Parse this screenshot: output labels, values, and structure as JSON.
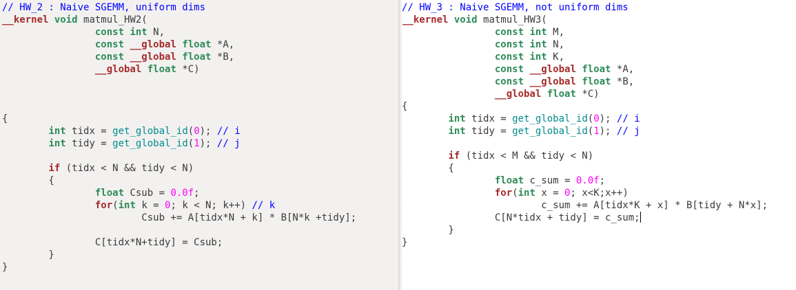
{
  "panes": [
    {
      "id": "hw2",
      "lines": [
        [
          {
            "t": "c",
            "v": "// HW_2 : Naive SGEMM, uniform dims"
          }
        ],
        [
          {
            "t": "k",
            "v": "__kernel"
          },
          {
            "t": "p",
            "v": " "
          },
          {
            "t": "t",
            "v": "void"
          },
          {
            "t": "p",
            "v": " matmul_HW2("
          }
        ],
        [
          {
            "t": "p",
            "v": "                "
          },
          {
            "t": "t",
            "v": "const"
          },
          {
            "t": "p",
            "v": " "
          },
          {
            "t": "t",
            "v": "int"
          },
          {
            "t": "p",
            "v": " N,"
          }
        ],
        [
          {
            "t": "p",
            "v": "                "
          },
          {
            "t": "t",
            "v": "const"
          },
          {
            "t": "p",
            "v": " "
          },
          {
            "t": "k",
            "v": "__global"
          },
          {
            "t": "p",
            "v": " "
          },
          {
            "t": "t",
            "v": "float"
          },
          {
            "t": "p",
            "v": " *A,"
          }
        ],
        [
          {
            "t": "p",
            "v": "                "
          },
          {
            "t": "t",
            "v": "const"
          },
          {
            "t": "p",
            "v": " "
          },
          {
            "t": "k",
            "v": "__global"
          },
          {
            "t": "p",
            "v": " "
          },
          {
            "t": "t",
            "v": "float"
          },
          {
            "t": "p",
            "v": " *B,"
          }
        ],
        [
          {
            "t": "p",
            "v": "                "
          },
          {
            "t": "k",
            "v": "__global"
          },
          {
            "t": "p",
            "v": " "
          },
          {
            "t": "t",
            "v": "float"
          },
          {
            "t": "p",
            "v": " *C)"
          }
        ],
        [],
        [],
        [],
        [
          {
            "t": "p",
            "v": "{"
          }
        ],
        [
          {
            "t": "p",
            "v": "        "
          },
          {
            "t": "t",
            "v": "int"
          },
          {
            "t": "p",
            "v": " tidx = "
          },
          {
            "t": "f",
            "v": "get_global_id"
          },
          {
            "t": "p",
            "v": "("
          },
          {
            "t": "n",
            "v": "0"
          },
          {
            "t": "p",
            "v": "); "
          },
          {
            "t": "c",
            "v": "// i"
          }
        ],
        [
          {
            "t": "p",
            "v": "        "
          },
          {
            "t": "t",
            "v": "int"
          },
          {
            "t": "p",
            "v": " tidy = "
          },
          {
            "t": "f",
            "v": "get_global_id"
          },
          {
            "t": "p",
            "v": "("
          },
          {
            "t": "n",
            "v": "1"
          },
          {
            "t": "p",
            "v": "); "
          },
          {
            "t": "c",
            "v": "// j"
          }
        ],
        [],
        [
          {
            "t": "p",
            "v": "        "
          },
          {
            "t": "k",
            "v": "if"
          },
          {
            "t": "p",
            "v": " (tidx < N && tidy < N)"
          }
        ],
        [
          {
            "t": "p",
            "v": "        {"
          }
        ],
        [
          {
            "t": "p",
            "v": "                "
          },
          {
            "t": "t",
            "v": "float"
          },
          {
            "t": "p",
            "v": " Csub = "
          },
          {
            "t": "n",
            "v": "0.0f"
          },
          {
            "t": "p",
            "v": ";"
          }
        ],
        [
          {
            "t": "p",
            "v": "                "
          },
          {
            "t": "k",
            "v": "for"
          },
          {
            "t": "p",
            "v": "("
          },
          {
            "t": "t",
            "v": "int"
          },
          {
            "t": "p",
            "v": " k = "
          },
          {
            "t": "n",
            "v": "0"
          },
          {
            "t": "p",
            "v": "; k < N; k++) "
          },
          {
            "t": "c",
            "v": "// k"
          }
        ],
        [
          {
            "t": "p",
            "v": "                        Csub += A[tidx*N + k] * B[N*k +tidy];"
          }
        ],
        [],
        [
          {
            "t": "p",
            "v": "                C[tidx*N+tidy] = Csub;"
          }
        ],
        [
          {
            "t": "p",
            "v": "        }"
          }
        ],
        [
          {
            "t": "p",
            "v": "}"
          }
        ]
      ]
    },
    {
      "id": "hw3",
      "cursor_line": 17,
      "lines": [
        [
          {
            "t": "c",
            "v": "// HW_3 : Naive SGEMM, not uniform dims"
          }
        ],
        [
          {
            "t": "k",
            "v": "__kernel"
          },
          {
            "t": "p",
            "v": " "
          },
          {
            "t": "t",
            "v": "void"
          },
          {
            "t": "p",
            "v": " matmul_HW3("
          }
        ],
        [
          {
            "t": "p",
            "v": "                "
          },
          {
            "t": "t",
            "v": "const"
          },
          {
            "t": "p",
            "v": " "
          },
          {
            "t": "t",
            "v": "int"
          },
          {
            "t": "p",
            "v": " M,"
          }
        ],
        [
          {
            "t": "p",
            "v": "                "
          },
          {
            "t": "t",
            "v": "const"
          },
          {
            "t": "p",
            "v": " "
          },
          {
            "t": "t",
            "v": "int"
          },
          {
            "t": "p",
            "v": " N,"
          }
        ],
        [
          {
            "t": "p",
            "v": "                "
          },
          {
            "t": "t",
            "v": "const"
          },
          {
            "t": "p",
            "v": " "
          },
          {
            "t": "t",
            "v": "int"
          },
          {
            "t": "p",
            "v": " K,"
          }
        ],
        [
          {
            "t": "p",
            "v": "                "
          },
          {
            "t": "t",
            "v": "const"
          },
          {
            "t": "p",
            "v": " "
          },
          {
            "t": "k",
            "v": "__global"
          },
          {
            "t": "p",
            "v": " "
          },
          {
            "t": "t",
            "v": "float"
          },
          {
            "t": "p",
            "v": " *A,"
          }
        ],
        [
          {
            "t": "p",
            "v": "                "
          },
          {
            "t": "t",
            "v": "const"
          },
          {
            "t": "p",
            "v": " "
          },
          {
            "t": "k",
            "v": "__global"
          },
          {
            "t": "p",
            "v": " "
          },
          {
            "t": "t",
            "v": "float"
          },
          {
            "t": "p",
            "v": " *B,"
          }
        ],
        [
          {
            "t": "p",
            "v": "                "
          },
          {
            "t": "k",
            "v": "__global"
          },
          {
            "t": "p",
            "v": " "
          },
          {
            "t": "t",
            "v": "float"
          },
          {
            "t": "p",
            "v": " *C)"
          }
        ],
        [
          {
            "t": "p",
            "v": "{"
          }
        ],
        [
          {
            "t": "p",
            "v": "        "
          },
          {
            "t": "t",
            "v": "int"
          },
          {
            "t": "p",
            "v": " tidx = "
          },
          {
            "t": "f",
            "v": "get_global_id"
          },
          {
            "t": "p",
            "v": "("
          },
          {
            "t": "n",
            "v": "0"
          },
          {
            "t": "p",
            "v": "); "
          },
          {
            "t": "c",
            "v": "// i"
          }
        ],
        [
          {
            "t": "p",
            "v": "        "
          },
          {
            "t": "t",
            "v": "int"
          },
          {
            "t": "p",
            "v": " tidy = "
          },
          {
            "t": "f",
            "v": "get_global_id"
          },
          {
            "t": "p",
            "v": "("
          },
          {
            "t": "n",
            "v": "1"
          },
          {
            "t": "p",
            "v": "); "
          },
          {
            "t": "c",
            "v": "// j"
          }
        ],
        [],
        [
          {
            "t": "p",
            "v": "        "
          },
          {
            "t": "k",
            "v": "if"
          },
          {
            "t": "p",
            "v": " (tidx < M && tidy < N)"
          }
        ],
        [
          {
            "t": "p",
            "v": "        {"
          }
        ],
        [
          {
            "t": "p",
            "v": "                "
          },
          {
            "t": "t",
            "v": "float"
          },
          {
            "t": "p",
            "v": " c_sum = "
          },
          {
            "t": "n",
            "v": "0.0f"
          },
          {
            "t": "p",
            "v": ";"
          }
        ],
        [
          {
            "t": "p",
            "v": "                "
          },
          {
            "t": "k",
            "v": "for"
          },
          {
            "t": "p",
            "v": "("
          },
          {
            "t": "t",
            "v": "int"
          },
          {
            "t": "p",
            "v": " x = "
          },
          {
            "t": "n",
            "v": "0"
          },
          {
            "t": "p",
            "v": "; x<K;x++)"
          }
        ],
        [
          {
            "t": "p",
            "v": "                        c_sum += A[tidx*K + x] * B[tidy + N*x];"
          }
        ],
        [
          {
            "t": "p",
            "v": "                C[N*tidx + tidy] = c_sum;"
          }
        ],
        [
          {
            "t": "p",
            "v": "        }"
          }
        ],
        [
          {
            "t": "p",
            "v": "}"
          }
        ]
      ]
    }
  ],
  "colors": {
    "comment": "#0000ff",
    "keyword": "#a52a2a",
    "type": "#2e8b57",
    "function": "#008b8b",
    "number": "#ff00ff",
    "text": "#3a3a3a",
    "left_background": "#f2f1f0",
    "right_background": "#ffffff"
  }
}
